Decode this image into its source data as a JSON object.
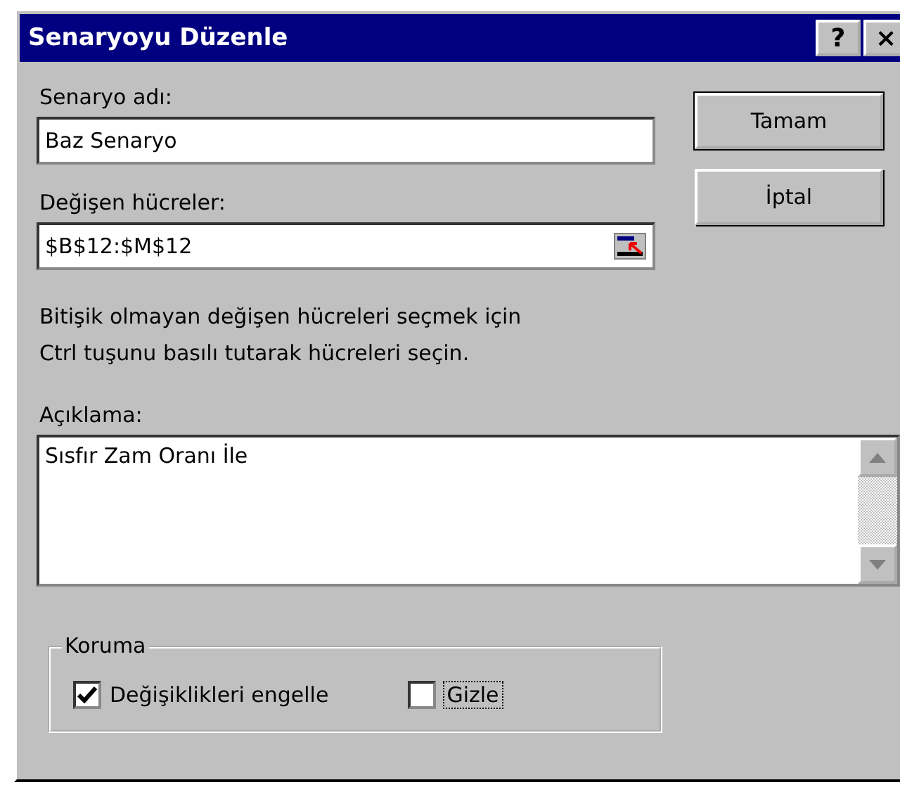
{
  "window": {
    "title": "Senaryoyu Düzenle",
    "title_buttons": [
      "?",
      "×"
    ]
  },
  "scenario_name": {
    "label": "Senaryo adı:",
    "value": "Baz Senaryo"
  },
  "changing_cells": {
    "label": "Değişen hücreler:",
    "value": "$B$12:$M$12"
  },
  "hint": [
    "Bitişik olmayan değişen hücreleri seçmek için",
    "Ctrl tuşunu basılı tutarak hücreleri seçin."
  ],
  "comment": {
    "label": "Açıklama:",
    "value": "Sısfır Zam Oranı İle"
  },
  "protection": {
    "title": "Koruma",
    "options": [
      {
        "label": "Değişiklikleri engelle",
        "checked": true,
        "focused": false
      },
      {
        "label": "Gizle",
        "checked": false,
        "focused": true
      }
    ]
  },
  "buttons": [
    "Tamam",
    "İptal"
  ]
}
